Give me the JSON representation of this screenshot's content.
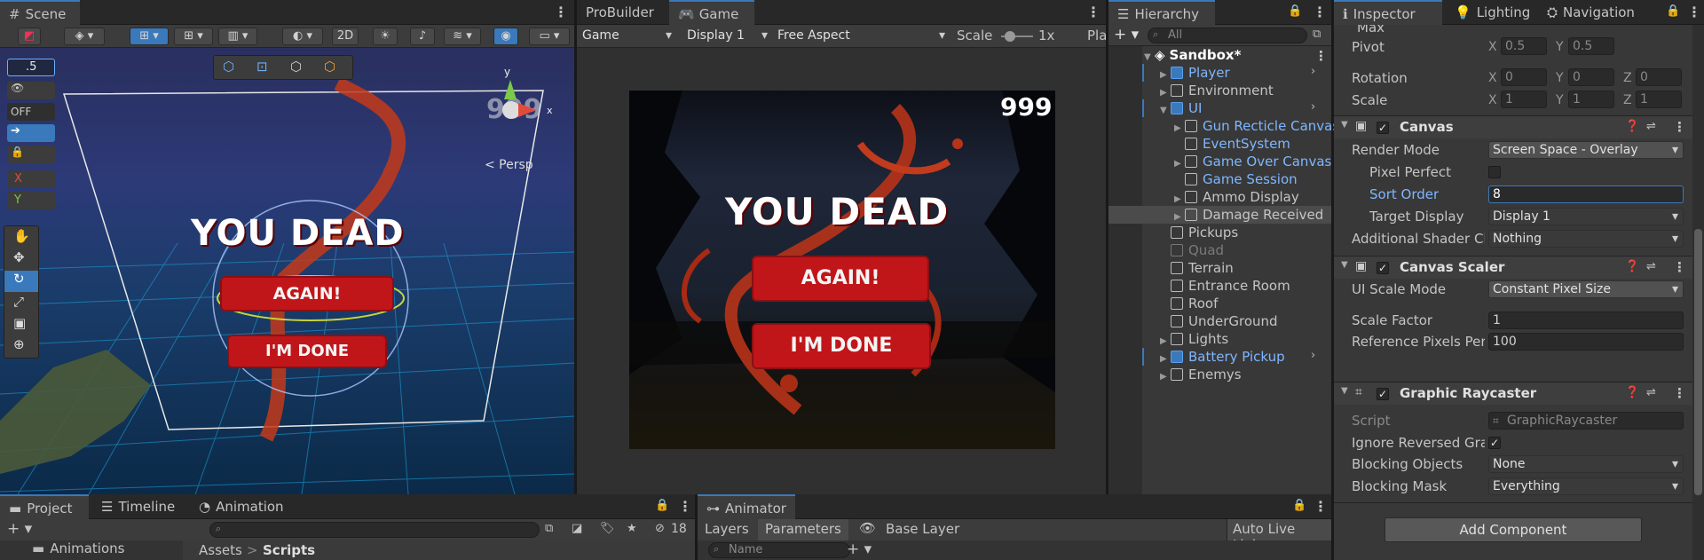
{
  "scene": {
    "tab": "Scene",
    "toolbar_2d": "2D",
    "snap_value": ".5",
    "persp_label": "< Persp",
    "gizmo_y": "y",
    "gizmo_x": "x",
    "off_label": "OFF",
    "axis_x": "X",
    "axis_y": "Y",
    "dead_text": "YOU DEAD",
    "again_label": "AGAIN!",
    "done_label": "I'M DONE",
    "score_ghost": "999"
  },
  "game": {
    "tabs": [
      "ProBuilder",
      "Game"
    ],
    "mode": "Game",
    "display": "Display 1",
    "aspect": "Free Aspect",
    "scale_label": "Scale",
    "scale_value": "1x",
    "play_label": "Pla",
    "score": "999",
    "dead_text": "YOU DEAD",
    "again_label": "AGAIN!",
    "done_label": "I'M DONE"
  },
  "hierarchy": {
    "tab": "Hierarchy",
    "search_placeholder": "All",
    "root": "Sandbox*",
    "items": [
      {
        "label": "Player",
        "color": "#7fb6ff",
        "depth": 1,
        "arrow": "▶",
        "icon": "blue"
      },
      {
        "label": "Environment",
        "color": "#c4c4c4",
        "depth": 1,
        "arrow": "▶",
        "icon": "plain"
      },
      {
        "label": "UI",
        "color": "#7fb6ff",
        "depth": 1,
        "arrow": "▼",
        "icon": "blue"
      },
      {
        "label": "Gun Recticle Canvas",
        "color": "#7fb6ff",
        "depth": 2,
        "arrow": "▶",
        "icon": "plain"
      },
      {
        "label": "EventSystem",
        "color": "#7fb6ff",
        "depth": 2,
        "arrow": "",
        "icon": "plain"
      },
      {
        "label": "Game Over Canvas",
        "color": "#7fb6ff",
        "depth": 2,
        "arrow": "▶",
        "icon": "plain"
      },
      {
        "label": "Game Session",
        "color": "#7fb6ff",
        "depth": 2,
        "arrow": "",
        "icon": "plain"
      },
      {
        "label": "Ammo Display",
        "color": "#c4c4c4",
        "depth": 2,
        "arrow": "▶",
        "icon": "plain"
      },
      {
        "label": "Damage Received",
        "color": "#c4c4c4",
        "depth": 2,
        "arrow": "▶",
        "icon": "plain"
      },
      {
        "label": "Pickups",
        "color": "#c4c4c4",
        "depth": 1,
        "arrow": "",
        "icon": "plain"
      },
      {
        "label": "Quad",
        "color": "#7a7a7a",
        "depth": 1,
        "arrow": "",
        "icon": "gray"
      },
      {
        "label": "Terrain",
        "color": "#c4c4c4",
        "depth": 1,
        "arrow": "",
        "icon": "plain"
      },
      {
        "label": "Entrance Room",
        "color": "#c4c4c4",
        "depth": 1,
        "arrow": "",
        "icon": "plain"
      },
      {
        "label": "Roof",
        "color": "#c4c4c4",
        "depth": 1,
        "arrow": "",
        "icon": "plain"
      },
      {
        "label": "UnderGround",
        "color": "#c4c4c4",
        "depth": 1,
        "arrow": "",
        "icon": "plain"
      },
      {
        "label": "Lights",
        "color": "#c4c4c4",
        "depth": 1,
        "arrow": "▶",
        "icon": "plain"
      },
      {
        "label": "Battery Pickup",
        "color": "#7fb6ff",
        "depth": 1,
        "arrow": "▶",
        "icon": "blue"
      },
      {
        "label": "Enemys",
        "color": "#c4c4c4",
        "depth": 1,
        "arrow": "▶",
        "icon": "plain"
      }
    ]
  },
  "inspector": {
    "tabs": [
      "Inspector",
      "Lighting",
      "Navigation"
    ],
    "max_label": "Max",
    "pivot": {
      "label": "Pivot",
      "x": "0.5",
      "y": "0.5"
    },
    "rotation": {
      "label": "Rotation",
      "x": "0",
      "y": "0",
      "z": "0"
    },
    "scale": {
      "label": "Scale",
      "x": "1",
      "y": "1",
      "z": "1"
    },
    "canvas": {
      "title": "Canvas",
      "render_mode_label": "Render Mode",
      "render_mode": "Screen Space - Overlay",
      "pixel_perfect_label": "Pixel Perfect",
      "sort_order_label": "Sort Order",
      "sort_order": "8",
      "target_display_label": "Target Display",
      "target_display": "Display 1",
      "shader_label": "Additional Shader Ch",
      "shader": "Nothing"
    },
    "scaler": {
      "title": "Canvas Scaler",
      "mode_label": "UI Scale Mode",
      "mode": "Constant Pixel Size",
      "factor_label": "Scale Factor",
      "factor": "1",
      "ref_label": "Reference Pixels Per",
      "ref": "100"
    },
    "raycaster": {
      "title": "Graphic Raycaster",
      "script_label": "Script",
      "script": "GraphicRaycaster",
      "ignore_label": "Ignore Reversed Gra",
      "blocking_objects_label": "Blocking Objects",
      "blocking_objects": "None",
      "blocking_mask_label": "Blocking Mask",
      "blocking_mask": "Everything"
    },
    "add_component": "Add Component"
  },
  "project": {
    "tabs": [
      "Project",
      "Timeline",
      "Animation"
    ],
    "count": "18",
    "folder": "Animations",
    "breadcrumb_root": "Assets",
    "breadcrumb_sep": ">",
    "breadcrumb_current": "Scripts"
  },
  "animator": {
    "tab": "Animator",
    "layers": "Layers",
    "parameters": "Parameters",
    "base_layer": "Base Layer",
    "auto_live": "Auto Live Link",
    "name_placeholder": "Name"
  },
  "colors": {
    "accent": "#3a79bb",
    "game_button": "#c0161a",
    "prefab_blue": "#7fb6ff"
  }
}
